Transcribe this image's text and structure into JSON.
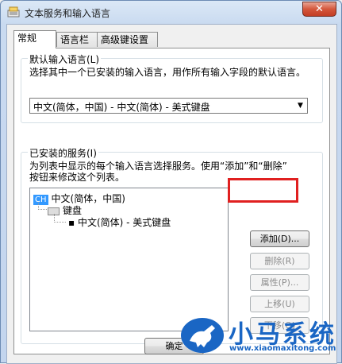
{
  "window": {
    "title": "文本服务和输入语言",
    "close_label": "✕"
  },
  "tabs": [
    {
      "label": "常规",
      "active": true
    },
    {
      "label": "语言栏",
      "active": false
    },
    {
      "label": "高级键设置",
      "active": false
    }
  ],
  "default_language": {
    "group_label": "默认输入语言(L)",
    "description": "选择其中一个已安装的输入语言，用作所有输入字段的默认语言。",
    "selected_value": "中文(简体，中国) - 中文(简体) - 美式键盘"
  },
  "installed_services": {
    "group_label": "已安装的服务(I)",
    "description_line1": "为列表中显示的每个输入语言选择服务。使用“添加”和“删除”",
    "description_line2": "按钮来修改这个列表。",
    "tree": {
      "language_tag": "CH",
      "language": "中文(简体，中国)",
      "category": "键盘",
      "service": "中文(简体) - 美式键盘"
    },
    "buttons": {
      "add": "添加(D)...",
      "remove": "删除(R)",
      "properties": "属性(P)...",
      "move_up": "上移(U)",
      "move_down": "下移(O)"
    }
  },
  "footer": {
    "ok_label": "确定"
  },
  "watermark": {
    "brand": "小马系统",
    "url": "www.xiaomaxitong.com"
  },
  "colors": {
    "highlight": "#e02020",
    "selection": "#3399ff",
    "watermark": "#1a66c4"
  }
}
